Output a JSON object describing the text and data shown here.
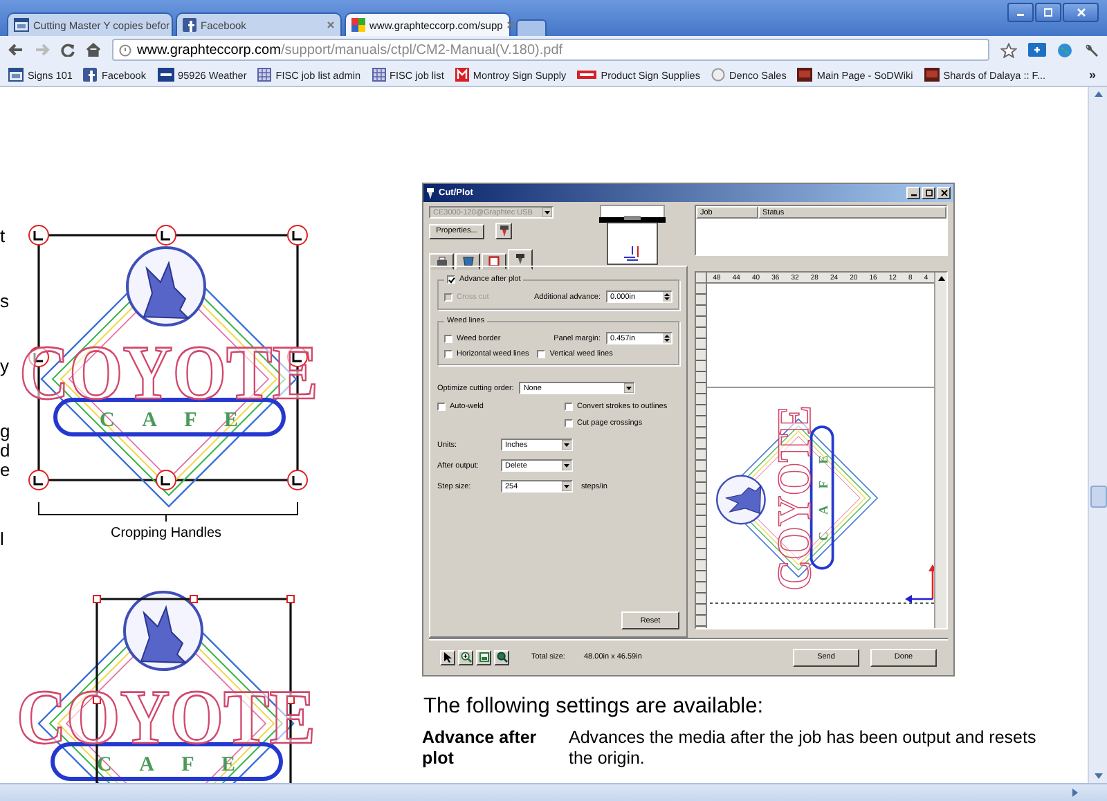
{
  "browser": {
    "tabs": [
      {
        "title": "Cutting Master Y copies befor",
        "selected": false
      },
      {
        "title": "Facebook",
        "selected": false
      },
      {
        "title": "www.graphteccorp.com/supp",
        "selected": true
      }
    ],
    "address": {
      "host": "www.graphteccorp.com",
      "path": "/support/manuals/ctpl/CM2-Manual(V.180).pdf"
    },
    "bookmarks": [
      {
        "label": "Signs 101"
      },
      {
        "label": "Facebook"
      },
      {
        "label": "95926 Weather"
      },
      {
        "label": "FISC job list admin"
      },
      {
        "label": "FISC job list"
      },
      {
        "label": "Montroy Sign Supply"
      },
      {
        "label": "Product Sign Supplies"
      },
      {
        "label": "Denco Sales"
      },
      {
        "label": "Main Page - SoDWiki"
      },
      {
        "label": "Shards of Dalaya :: F..."
      }
    ],
    "bookmarks_overflow": "»"
  },
  "page": {
    "margin_fragments": [
      "t",
      "s",
      "y",
      "g",
      "d",
      "e",
      "l"
    ],
    "figures": [
      {
        "logo_title": "COYOTE",
        "logo_subtitle": "CAFE",
        "caption": "Cropping Handles"
      },
      {
        "logo_title": "COYOTE",
        "logo_subtitle": "CAFE"
      }
    ],
    "dialog": {
      "title": "Cut/Plot",
      "device": "CE3000-120@Graphtec USB",
      "device_disabled": true,
      "properties_button": "Properties...",
      "tabs": [
        {
          "selected": false
        },
        {
          "selected": false
        },
        {
          "selected": false
        },
        {
          "selected": true
        }
      ],
      "job_columns": [
        "Job",
        "Status"
      ],
      "advance": {
        "label": "Advance after plot",
        "checked": true
      },
      "cross_cut": {
        "label": "Cross cut",
        "checked": false,
        "disabled": true
      },
      "additional_advance": {
        "label": "Additional advance:",
        "value": "0.000in"
      },
      "weed_group": "Weed lines",
      "weed_border": {
        "label": "Weed border",
        "checked": false
      },
      "panel_margin": {
        "label": "Panel margin:",
        "value": "0.457in"
      },
      "horizontal_weed": {
        "label": "Horizontal weed lines",
        "checked": false
      },
      "vertical_weed": {
        "label": "Vertical weed lines",
        "checked": false
      },
      "optimize": {
        "label": "Optimize cutting order:",
        "value": "None"
      },
      "options": [
        {
          "label": "Auto-weld",
          "checked": false
        },
        {
          "label": "Convert strokes to outlines",
          "checked": false
        },
        {
          "label": "Cut page crossings",
          "checked": false
        }
      ],
      "selects": [
        {
          "label": "Units:",
          "value": "Inches"
        },
        {
          "label": "After output:",
          "value": "Delete"
        },
        {
          "label": "Step size:",
          "value": "254",
          "unit": "steps/in"
        }
      ],
      "reset": "Reset",
      "ruler_ticks": [
        "48",
        "44",
        "40",
        "36",
        "32",
        "28",
        "24",
        "20",
        "16",
        "12",
        "8",
        "4"
      ],
      "preview_logo": {
        "title": "COYOTE",
        "subtitle": "CAFE"
      },
      "total_size": {
        "label": "Total size:",
        "value": "48.00in x 46.59in"
      },
      "buttons": [
        "Send",
        "Done"
      ]
    },
    "heading": "The following settings are available:",
    "definitions": [
      {
        "term": "Advance after plot",
        "description": "Advances the media after the job has been output and resets the origin."
      }
    ]
  }
}
